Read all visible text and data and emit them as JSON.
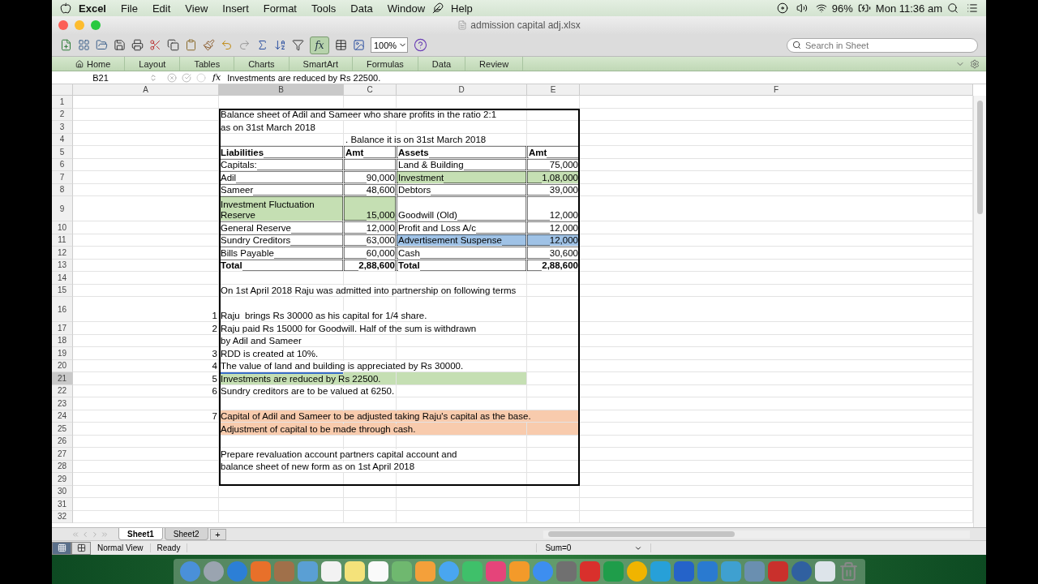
{
  "menu_bar": {
    "app": "Excel",
    "items": [
      "File",
      "Edit",
      "View",
      "Insert",
      "Format",
      "Tools",
      "Data",
      "Window"
    ],
    "help": "Help",
    "battery": "96%",
    "clock": "Mon 11:36 am"
  },
  "window": {
    "title": "admission capital adj.xlsx"
  },
  "toolbar": {
    "formula_button": "fx",
    "zoom": "100%",
    "search": {
      "placeholder": "Search in Sheet"
    }
  },
  "ribbon_tabs": [
    "Home",
    "Layout",
    "Tables",
    "Charts",
    "SmartArt",
    "Formulas",
    "Data",
    "Review"
  ],
  "formula_bar": {
    "cell_ref": "B21",
    "fx_label": "fx",
    "content": "Investments are reduced by Rs 22500."
  },
  "columns": [
    {
      "label": "A",
      "selected": false
    },
    {
      "label": "B",
      "selected": true
    },
    {
      "label": "C",
      "selected": false
    },
    {
      "label": "D",
      "selected": false
    },
    {
      "label": "E",
      "selected": false
    },
    {
      "label": "F",
      "selected": false
    }
  ],
  "rows": [
    {
      "number": "1",
      "selected": false
    },
    {
      "number": "2",
      "selected": false,
      "B": {
        "text": "Balance sheet of Adil and Sameer who share profits in the ratio 2:1"
      }
    },
    {
      "number": "3",
      "selected": false,
      "B": {
        "text": "as on 31st March 2018"
      }
    },
    {
      "number": "4",
      "selected": false,
      "C": {
        "text": ". Balance it is on 31st March 2018"
      }
    },
    {
      "number": "5",
      "selected": false,
      "B": {
        "text": "Liabilities",
        "bold": true,
        "bordered": true
      },
      "C": {
        "text": "Amt",
        "bold": true,
        "bordered": true
      },
      "D": {
        "text": "Assets",
        "bold": true,
        "bordered": true
      },
      "E": {
        "text": "Amt",
        "bold": true,
        "bordered": true
      }
    },
    {
      "number": "6",
      "selected": false,
      "B": {
        "text": "Capitals:",
        "bordered": true
      },
      "C": {
        "bordered": true
      },
      "D": {
        "text": "Land & Building",
        "bordered": true
      },
      "E": {
        "text": "75,000",
        "right": true,
        "bordered": true
      }
    },
    {
      "number": "7",
      "selected": false,
      "B": {
        "text": "Adil",
        "bordered": true
      },
      "C": {
        "text": "90,000",
        "right": true,
        "bordered": true
      },
      "D": {
        "text": "Investment",
        "bordered": true,
        "color": "#c5dfb3"
      },
      "E": {
        "text": "1,08,000",
        "right": true,
        "bordered": true,
        "color": "#c5dfb3"
      }
    },
    {
      "number": "8",
      "selected": false,
      "B": {
        "text": "Sameer",
        "bordered": true
      },
      "C": {
        "text": "48,600",
        "right": true,
        "bordered": true
      },
      "D": {
        "text": "Debtors",
        "bordered": true
      },
      "E": {
        "text": "39,000",
        "right": true,
        "bordered": true
      }
    },
    {
      "number": "9",
      "selected": false,
      "tall": true,
      "B": {
        "text": "Investment Fluctuation Reserve",
        "wrap": true,
        "bordered": true,
        "color": "#c5dfb3"
      },
      "C": {
        "text": "15,000",
        "right": true,
        "bordered": true,
        "color": "#c5dfb3"
      },
      "D": {
        "text": "Goodwill (Old)",
        "bordered": true
      },
      "E": {
        "text": "12,000",
        "right": true,
        "bordered": true
      }
    },
    {
      "number": "10",
      "selected": false,
      "B": {
        "text": "General Reserve",
        "bordered": true
      },
      "C": {
        "text": "12,000",
        "right": true,
        "bordered": true
      },
      "D": {
        "text": "Profit and Loss A/c",
        "bordered": true
      },
      "E": {
        "text": "12,000",
        "right": true,
        "bordered": true
      }
    },
    {
      "number": "11",
      "selected": false,
      "B": {
        "text": "Sundry Creditors",
        "bordered": true
      },
      "C": {
        "text": "63,000",
        "right": true,
        "bordered": true
      },
      "D": {
        "text": "Advertisement Suspense",
        "bordered": true,
        "color": "#9fc2e6"
      },
      "E": {
        "text": "12,000",
        "right": true,
        "bordered": true,
        "color": "#9fc2e6"
      }
    },
    {
      "number": "12",
      "selected": false,
      "B": {
        "text": "Bills Payable",
        "bordered": true
      },
      "C": {
        "text": "60,000",
        "right": true,
        "bordered": true
      },
      "D": {
        "text": "Cash",
        "bordered": true
      },
      "E": {
        "text": "30,600",
        "right": true,
        "bordered": true
      }
    },
    {
      "number": "13",
      "selected": false,
      "B": {
        "text": "Total",
        "bold": true,
        "bordered": true
      },
      "C": {
        "text": "2,88,600",
        "right": true,
        "bold": true,
        "bordered": true
      },
      "D": {
        "text": "Total",
        "bold": true,
        "bordered": true
      },
      "E": {
        "text": "2,88,600",
        "right": true,
        "bold": true,
        "bordered": true
      }
    },
    {
      "number": "14",
      "selected": false
    },
    {
      "number": "15",
      "selected": false,
      "B": {
        "text": "On 1st April 2018 Raju was admitted into partnership on following terms"
      }
    },
    {
      "number": "16",
      "selected": false,
      "tall": true,
      "A": {
        "text": "1",
        "right": true
      },
      "B": {
        "text": "Raju  brings Rs 30000 as his capital for 1/4 share."
      }
    },
    {
      "number": "17",
      "selected": false,
      "A": {
        "text": "2",
        "right": true
      },
      "B": {
        "text": "Raju paid Rs 15000 for Goodwill. Half of the sum is withdrawn"
      }
    },
    {
      "number": "18",
      "selected": false,
      "B": {
        "text": "by Adil and Sameer"
      }
    },
    {
      "number": "19",
      "selected": false,
      "A": {
        "text": "3",
        "right": true
      },
      "B": {
        "text": "RDD is created at 10%."
      }
    },
    {
      "number": "20",
      "selected": false,
      "A": {
        "text": "4",
        "right": true
      },
      "B": {
        "text": "The value of land and building is appreciated by Rs 30000."
      }
    },
    {
      "number": "21",
      "selected": true,
      "A": {
        "text": "5",
        "right": true
      },
      "B": {
        "text": "Investments are reduced by Rs 22500.",
        "color": "#c5dfb3"
      },
      "C": {
        "color": "#c5dfb3"
      },
      "D": {
        "color": "#c5dfb3"
      }
    },
    {
      "number": "22",
      "selected": false,
      "A": {
        "text": "6",
        "right": true
      },
      "B": {
        "text": "Sundry creditors are to be valued at 6250."
      }
    },
    {
      "number": "23",
      "selected": false
    },
    {
      "number": "24",
      "selected": false,
      "A": {
        "text": "7",
        "right": true
      },
      "B": {
        "text": "Capital of Adil and Sameer to be adjusted taking Raju's capital as the base.",
        "color": "#f8cbad"
      },
      "C": {
        "color": "#f8cbad"
      },
      "D": {
        "color": "#f8cbad"
      },
      "E": {
        "color": "#f8cbad"
      }
    },
    {
      "number": "25",
      "selected": false,
      "B": {
        "text": "Adjustment of capital to be made through cash.",
        "color": "#f8cbad"
      },
      "C": {
        "color": "#f8cbad"
      },
      "D": {
        "color": "#f8cbad"
      },
      "E": {
        "color": "#f8cbad"
      }
    },
    {
      "number": "26",
      "selected": false
    },
    {
      "number": "27",
      "selected": false,
      "B": {
        "text": "Prepare revaluation account partners capital account and"
      }
    },
    {
      "number": "28",
      "selected": false,
      "B": {
        "text": "balance sheet of new form as on 1st April 2018"
      }
    },
    {
      "number": "29",
      "selected": false
    },
    {
      "number": "30",
      "selected": false
    },
    {
      "number": "31",
      "selected": false
    },
    {
      "number": "32",
      "selected": false
    }
  ],
  "sheet_tabs": [
    {
      "label": "Sheet1",
      "selected": true
    },
    {
      "label": "Sheet2",
      "selected": false
    }
  ],
  "add_sheet": "+",
  "status_bar": {
    "view": "Normal View",
    "state": "Ready",
    "sum": "Sum=0"
  }
}
